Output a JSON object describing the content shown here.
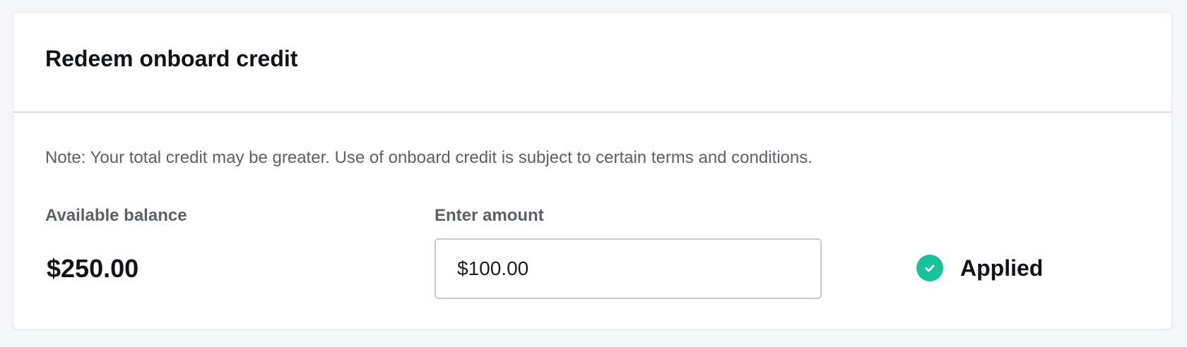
{
  "card": {
    "title": "Redeem onboard credit",
    "note": "Note: Your total credit may be greater. Use of onboard credit is subject to certain terms and conditions."
  },
  "balance": {
    "label": "Available balance",
    "value": "$250.00"
  },
  "amount": {
    "label": "Enter amount",
    "value": "$100.00"
  },
  "status": {
    "icon": "check-circle-icon",
    "label": "Applied",
    "color": "#17c49a"
  }
}
